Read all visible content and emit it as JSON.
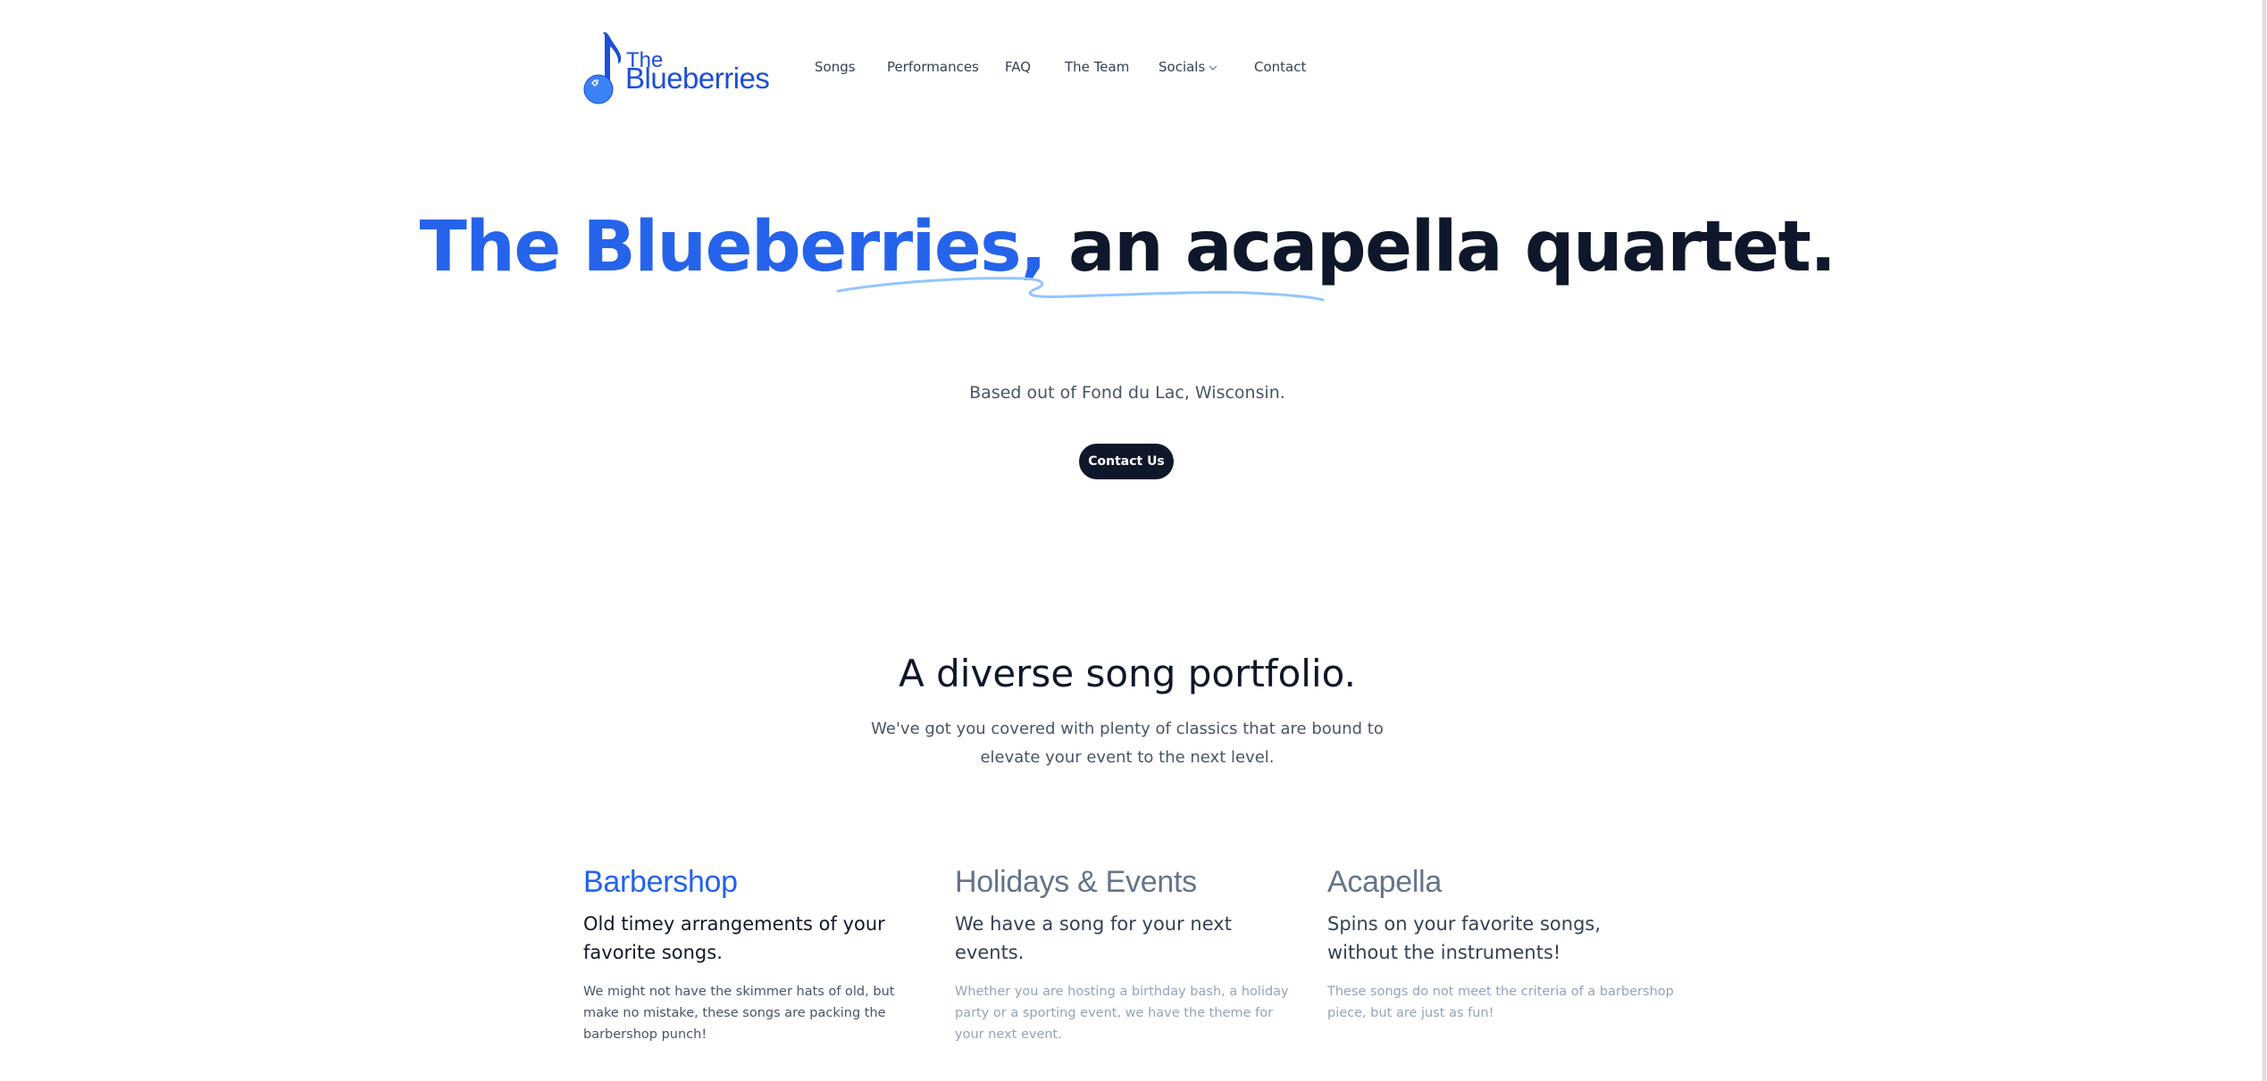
{
  "brand": {
    "logo_the": "The",
    "logo_name": "Blueberries",
    "accent_color": "#2563eb",
    "dark_color": "#0f172a"
  },
  "nav": {
    "items": [
      {
        "label": "Songs"
      },
      {
        "label": "Performances"
      },
      {
        "label": "FAQ"
      },
      {
        "label": "The Team"
      },
      {
        "label": "Socials",
        "icon": "chevron-down-icon"
      },
      {
        "label": "Contact"
      }
    ]
  },
  "hero": {
    "title_accent": "The Blueberries,",
    "title_rest": " an acapella quartet.",
    "subtitle": "Based out of Fond du Lac, Wisconsin.",
    "cta_label": "Contact Us"
  },
  "portfolio": {
    "title": "A diverse song portfolio.",
    "subtitle": "We've got you covered with plenty of classics that are bound to elevate your event to the next level.",
    "cards": [
      {
        "title": "Barbershop",
        "subtitle": "Old timey arrangements of your favorite songs.",
        "body": "We might not have the skimmer hats of old, but make no mistake, these songs are packing the barbershop punch!",
        "state": "active"
      },
      {
        "title": "Holidays & Events",
        "subtitle": "We have a song for your next events.",
        "body": "Whether you are hosting a birthday bash, a holiday party or a sporting event, we have the theme for your next event.",
        "state": "inactive"
      },
      {
        "title": "Acapella",
        "subtitle": "Spins on your favorite songs, without the instruments!",
        "body": "These songs do not meet the criteria of a barbershop piece, but are just as fun!",
        "state": "inactive"
      }
    ]
  }
}
